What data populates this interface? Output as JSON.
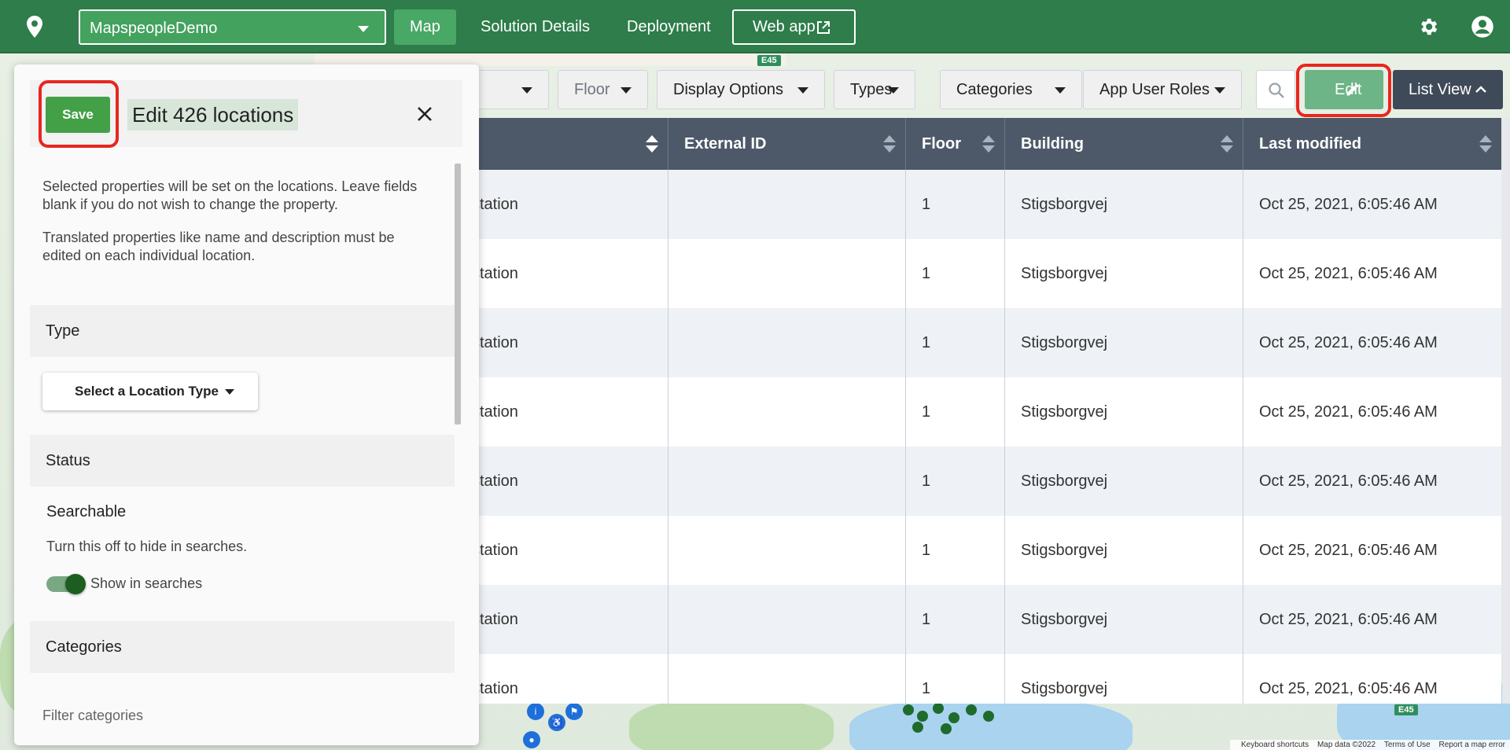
{
  "topbar": {
    "logo_icon": "map-pin-icon",
    "solution": "MapspeopleDemo",
    "nav": [
      {
        "label": "Map",
        "active": true
      },
      {
        "label": "Solution Details",
        "active": false
      },
      {
        "label": "Deployment",
        "active": false
      }
    ],
    "webapp_label": "Web app",
    "webapp_icon": "external-link-icon",
    "settings_icon": "gear-icon",
    "account_icon": "account-icon"
  },
  "toolbar": {
    "floor": "Floor",
    "display_options": "Display Options",
    "types": "Types",
    "categories": "Categories",
    "app_user_roles": "App User Roles",
    "search_icon": "search-icon",
    "edit": "Edit",
    "list_view": "List View"
  },
  "table": {
    "columns": [
      "",
      "External ID",
      "Floor",
      "Building",
      "Last modified"
    ],
    "rows": [
      [
        "station",
        "",
        "1",
        "Stigsborgvej",
        "Oct 25, 2021, 6:05:46 AM"
      ],
      [
        "station",
        "",
        "1",
        "Stigsborgvej",
        "Oct 25, 2021, 6:05:46 AM"
      ],
      [
        "station",
        "",
        "1",
        "Stigsborgvej",
        "Oct 25, 2021, 6:05:46 AM"
      ],
      [
        "station",
        "",
        "1",
        "Stigsborgvej",
        "Oct 25, 2021, 6:05:46 AM"
      ],
      [
        "station",
        "",
        "1",
        "Stigsborgvej",
        "Oct 25, 2021, 6:05:46 AM"
      ],
      [
        "station",
        "",
        "1",
        "Stigsborgvej",
        "Oct 25, 2021, 6:05:46 AM"
      ],
      [
        "station",
        "",
        "1",
        "Stigsborgvej",
        "Oct 25, 2021, 6:05:46 AM"
      ],
      [
        "station",
        "",
        "1",
        "Stigsborgvej",
        "Oct 25, 2021, 6:05:46 AM"
      ]
    ]
  },
  "panel": {
    "save": "Save",
    "title": "Edit 426 locations",
    "desc1": "Selected properties will be set on the locations. Leave fields blank if you do not wish to change the property.",
    "desc2": "Translated properties like name and description must be edited on each individual location.",
    "type_heading": "Type",
    "type_select": "Select a Location Type",
    "status_heading": "Status",
    "searchable_label": "Searchable",
    "searchable_help": "Turn this off to hide in searches.",
    "toggle_label": "Show in searches",
    "toggle_on": true,
    "categories_heading": "Categories",
    "filter_label": "Filter categories"
  },
  "map": {
    "shields": [
      "E45",
      "E45"
    ],
    "attribution": [
      "Keyboard shortcuts",
      "Map data ©2022",
      "Terms of Use",
      "Report a map error"
    ]
  },
  "colors": {
    "brand_green": "#2e7d4a",
    "active_nav": "#49a865",
    "header_dark": "#4d5969",
    "highlight_red": "#e8261f",
    "save_green": "#43a047"
  }
}
